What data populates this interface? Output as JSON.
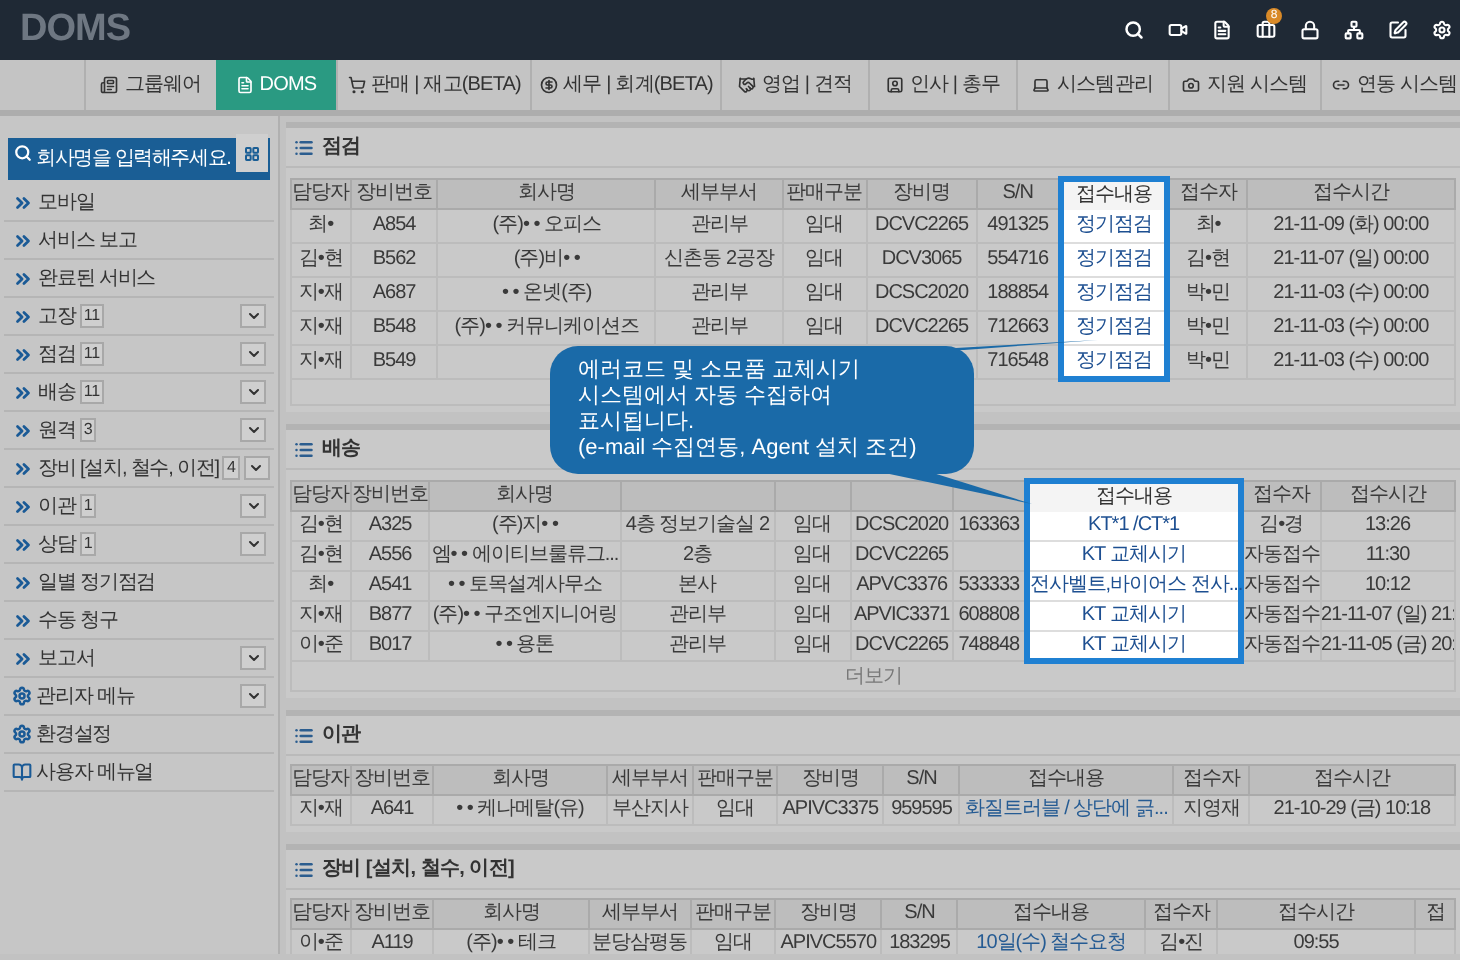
{
  "header": {
    "logo": "DOMS",
    "notification_badge": "8"
  },
  "nav_tabs": [
    {
      "label": "그룹웨어",
      "selected": false
    },
    {
      "label": "DOMS",
      "selected": true
    },
    {
      "label": "판매 | 재고(BETA)",
      "selected": false
    },
    {
      "label": "세무 | 회계(BETA)",
      "selected": false
    },
    {
      "label": "영업 | 견적",
      "selected": false
    },
    {
      "label": "인사 | 총무",
      "selected": false
    },
    {
      "label": "시스템관리",
      "selected": false
    },
    {
      "label": "지원 시스템",
      "selected": false
    },
    {
      "label": "연동 시스템",
      "selected": false
    }
  ],
  "sidebar": {
    "search": {
      "placeholder": "회사명을 입력해주세요."
    },
    "items": [
      {
        "kind": "link",
        "label": "모바일"
      },
      {
        "kind": "link",
        "label": "서비스 보고"
      },
      {
        "kind": "link",
        "label": "완료된 서비스"
      },
      {
        "kind": "link",
        "label": "고장",
        "count": "11",
        "expandable": true
      },
      {
        "kind": "link",
        "label": "점검",
        "count": "11",
        "expandable": true
      },
      {
        "kind": "link",
        "label": "배송",
        "count": "11",
        "expandable": true
      },
      {
        "kind": "link",
        "label": "원격",
        "count": "3",
        "expandable": true
      },
      {
        "kind": "link",
        "label": "장비 [설치, 철수, 이전]",
        "count": "4",
        "expandable": true
      },
      {
        "kind": "link",
        "label": "이관",
        "count": "1",
        "expandable": true
      },
      {
        "kind": "link",
        "label": "상담",
        "count": "1",
        "expandable": true
      },
      {
        "kind": "link",
        "label": "일별 정기점검"
      },
      {
        "kind": "link",
        "label": "수동 청구"
      },
      {
        "kind": "link",
        "label": "보고서",
        "expandable": true
      },
      {
        "kind": "settings",
        "label": "관리자 메뉴",
        "expandable": true
      },
      {
        "kind": "settings",
        "label": "환경설정"
      },
      {
        "kind": "manual",
        "label": "사용자 메뉴얼"
      }
    ]
  },
  "sections": [
    {
      "title": "점검",
      "columns": [
        {
          "label": "담당자",
          "highlighted": false
        },
        {
          "label": "장비번호",
          "highlighted": false
        },
        {
          "label": "회사명",
          "highlighted": false
        },
        {
          "label": "세부부서",
          "highlighted": false
        },
        {
          "label": "판매구분",
          "highlighted": false
        },
        {
          "label": "장비명",
          "highlighted": false
        },
        {
          "label": "S/N",
          "highlighted": false
        },
        {
          "label": "접수내용",
          "highlighted": true
        },
        {
          "label": "접수자",
          "highlighted": false
        },
        {
          "label": "접수시간",
          "highlighted": false
        }
      ],
      "rows": [
        [
          "최•",
          "A854",
          "(주)• • 오피스",
          "관리부",
          "임대",
          "DCVC2265",
          "491325",
          "정기점검",
          "최•",
          "21-11-09 (화) 00:00"
        ],
        [
          "김•현",
          "B562",
          "(주)비• •",
          "신촌동 2공장",
          "임대",
          "DCV3065",
          "554716",
          "정기점검",
          "김•현",
          "21-11-07 (일) 00:00"
        ],
        [
          "지•재",
          "A687",
          "• • 온넷(주)",
          "관리부",
          "임대",
          "DCSC2020",
          "188854",
          "정기점검",
          "박•민",
          "21-11-03 (수) 00:00"
        ],
        [
          "지•재",
          "B548",
          "(주)• • 커뮤니케이션즈",
          "관리부",
          "임대",
          "DCVC2265",
          "712663",
          "정기점검",
          "박•민",
          "21-11-03 (수) 00:00"
        ],
        [
          "지•재",
          "B549",
          null,
          null,
          null,
          null,
          "716548",
          "정기점검",
          "박•민",
          "21-11-03 (수) 00:00"
        ]
      ]
    },
    {
      "title": "배송",
      "more": "더보기",
      "columns": [
        {
          "label": "담당자",
          "highlighted": false
        },
        {
          "label": "장비번호",
          "highlighted": false
        },
        {
          "label": "회사명",
          "highlighted": false
        },
        {
          "highlighted": false
        },
        {
          "highlighted": false
        },
        {
          "highlighted": false
        },
        {
          "highlighted": false
        },
        {
          "label": "접수내용",
          "highlighted": true
        },
        {
          "label": "접수자",
          "highlighted": false
        },
        {
          "label": "접수시간",
          "highlighted": false
        }
      ],
      "rows": [
        [
          "김•현",
          "A325",
          "(주)지• •",
          "4층 정보기술실 2",
          "임대",
          "DCSC2020",
          "163363",
          "KT*1 /CT*1",
          "김•경",
          "13:26"
        ],
        [
          "김•현",
          "A556",
          "엠• • 에이티브룰류그...",
          "2층",
          "임대",
          "DCVC2265",
          null,
          "KT 교체시기",
          "자동접수",
          "11:30"
        ],
        [
          "최•",
          "A541",
          "• • 토목설계사무소",
          "본사",
          "임대",
          "APVC3376",
          "533333",
          "전사벨트,바이어스 전사...",
          "자동접수",
          "10:12"
        ],
        [
          "지•재",
          "B877",
          "(주)• • 구조엔지니어링",
          "관리부",
          "임대",
          "APVIC3371",
          "608808",
          "KT 교체시기",
          "자동접수",
          "21-11-07 (일) 21:"
        ],
        [
          "이•준",
          "B017",
          "• • 용톤",
          "관리부",
          "임대",
          "DCVC2265",
          "748848",
          "KT 교체시기",
          "자동접수",
          "21-11-05 (금) 20:"
        ]
      ]
    },
    {
      "title": "이관",
      "columns": [
        {
          "label": "담당자",
          "highlighted": false
        },
        {
          "label": "장비번호",
          "highlighted": false
        },
        {
          "label": "회사명",
          "highlighted": false
        },
        {
          "label": "세부부서",
          "highlighted": false
        },
        {
          "label": "판매구분",
          "highlighted": false
        },
        {
          "label": "장비명",
          "highlighted": false
        },
        {
          "label": "S/N",
          "highlighted": false
        },
        {
          "label": "접수내용",
          "highlighted": false
        },
        {
          "label": "접수자",
          "highlighted": false
        },
        {
          "label": "접수시간",
          "highlighted": false
        }
      ],
      "rows": [
        [
          "지•재",
          "A641",
          "• • 케나메탈(유)",
          "부산지사",
          "임대",
          "APIVC3375",
          "959595",
          "화질트러블 / 상단에 긁...",
          "지영재",
          "21-10-29 (금) 10:18"
        ]
      ]
    },
    {
      "title": "장비 [설치, 철수, 이전]",
      "columns": [
        {
          "label": "담당자",
          "highlighted": false
        },
        {
          "label": "장비번호",
          "highlighted": false
        },
        {
          "label": "회사명",
          "highlighted": false
        },
        {
          "label": "세부부서",
          "highlighted": false
        },
        {
          "label": "판매구분",
          "highlighted": false
        },
        {
          "label": "장비명",
          "highlighted": false
        },
        {
          "label": "S/N",
          "highlighted": false
        },
        {
          "label": "접수내용",
          "highlighted": false
        },
        {
          "label": "접수자",
          "highlighted": false
        },
        {
          "label": "접수시간",
          "highlighted": false
        },
        {
          "label": "접",
          "highlighted": false
        }
      ],
      "rows": [
        [
          "이•준",
          "A119",
          "(주)• • 테크",
          "분당삼평동",
          "임대",
          "APIVC5570",
          "183295",
          "10일(수) 철수요청",
          "김•진",
          "09:55",
          null
        ]
      ]
    }
  ],
  "callout": {
    "lines": [
      "에러코드 및 소모품 교체시기",
      "시스템에서 자동 수집하여",
      "표시됩니다.",
      "(e-mail 수집연동, Agent 설치 조건)"
    ]
  }
}
